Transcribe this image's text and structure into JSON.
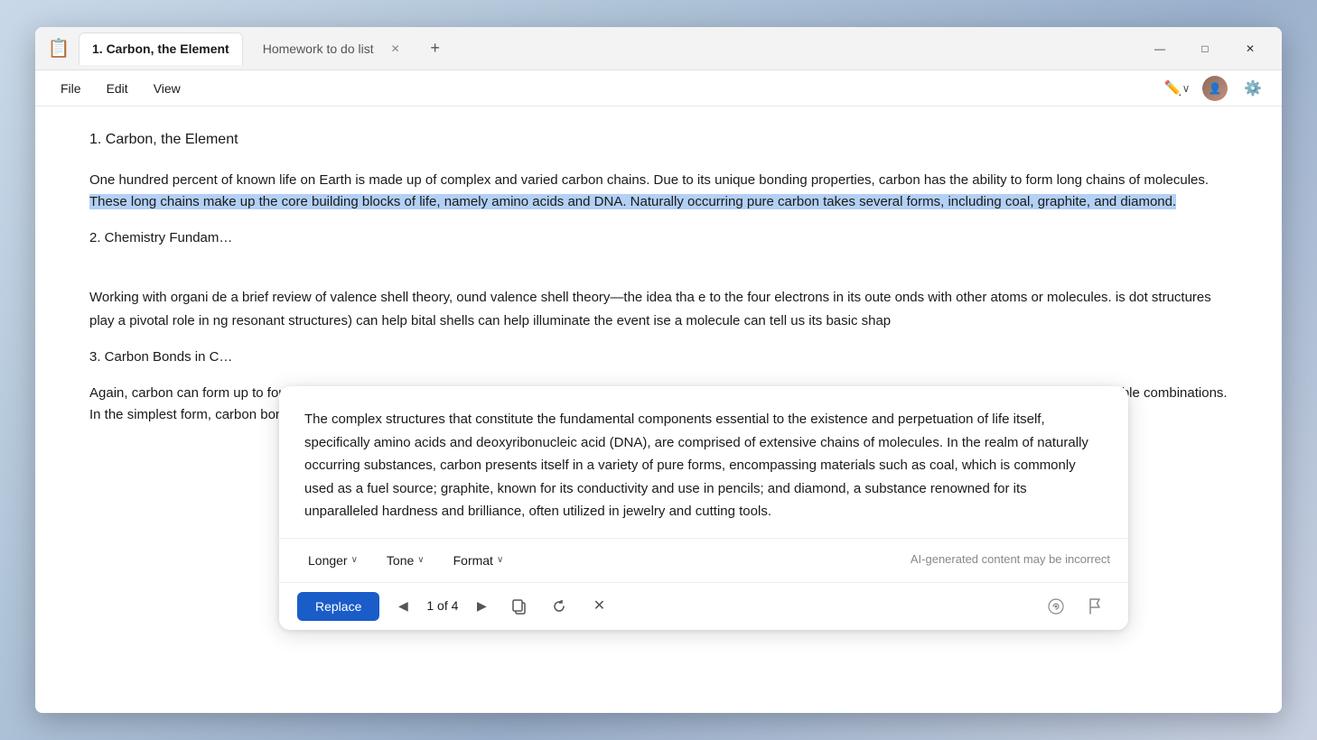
{
  "window": {
    "title": "1. Carbon, the Element",
    "icon": "📋"
  },
  "tabs": {
    "active": {
      "label": "1. Carbon, the Element"
    },
    "inactive": {
      "label": "Homework to do list"
    },
    "add_label": "+"
  },
  "window_controls": {
    "minimize": "—",
    "maximize": "□",
    "close": "✕"
  },
  "menu": {
    "items": [
      "File",
      "Edit",
      "View"
    ]
  },
  "toolbar": {
    "ai_icon": "✏️",
    "settings_icon": "⚙️"
  },
  "document": {
    "heading1": "1. Carbon, the Element",
    "paragraph1_pre": "One hundred percent of known life on Earth is made up of complex and varied carbon chains. Due to its unique bonding properties, carbon has the ability to form long chains of molecules. ",
    "paragraph1_selected": "These long chains make up the core building blocks of life, namely amino acids and DNA. Naturally occurring pure carbon takes several forms, including coal, graphite, and diamond.",
    "paragraph1_post": "",
    "heading2": "2. Chemistry Fundam",
    "paragraph2": "Working with organi                                                                                              de a brief review of valence shell theory,                                                                                         ound valence shell theory—the idea tha                                                                                              e to the four electrons in its oute                                                                                                onds with other atoms or molecules.                                                                                                 is dot structures play a pivotal role in                                                                                             ng resonant structures) can help                                                                                                     bital shells can help illuminate the event                                                                                           ise a molecule can tell us its basic shap",
    "heading3": "3. Carbon Bonds in C",
    "paragraph3": "Again, carbon can form up to four bonds with other molecules. In organic chemistry, we mainly focus on carbon chains with hydrogen and oxygen, but there are infinite possible combinations. In the simplest form, carbon bonds with four hydrogen in single bonds. In other instances"
  },
  "ai_popup": {
    "content": "The complex structures that constitute the fundamental components essential to the existence and perpetuation of life itself, specifically amino acids and deoxyribonucleic acid (DNA), are comprised of extensive chains of molecules. In the realm of naturally occurring substances, carbon presents itself in a variety of pure forms, encompassing materials such as coal, which is commonly used as a fuel source; graphite, known for its conductivity and use in pencils; and diamond, a substance renowned for its unparalleled hardness and brilliance, often utilized in jewelry and cutting tools.",
    "toolbar": {
      "longer_label": "Longer",
      "tone_label": "Tone",
      "format_label": "Format",
      "disclaimer": "AI-generated content may be incorrect"
    },
    "actions": {
      "replace_label": "Replace",
      "counter": "1 of 4",
      "of_label": "of 4"
    }
  }
}
